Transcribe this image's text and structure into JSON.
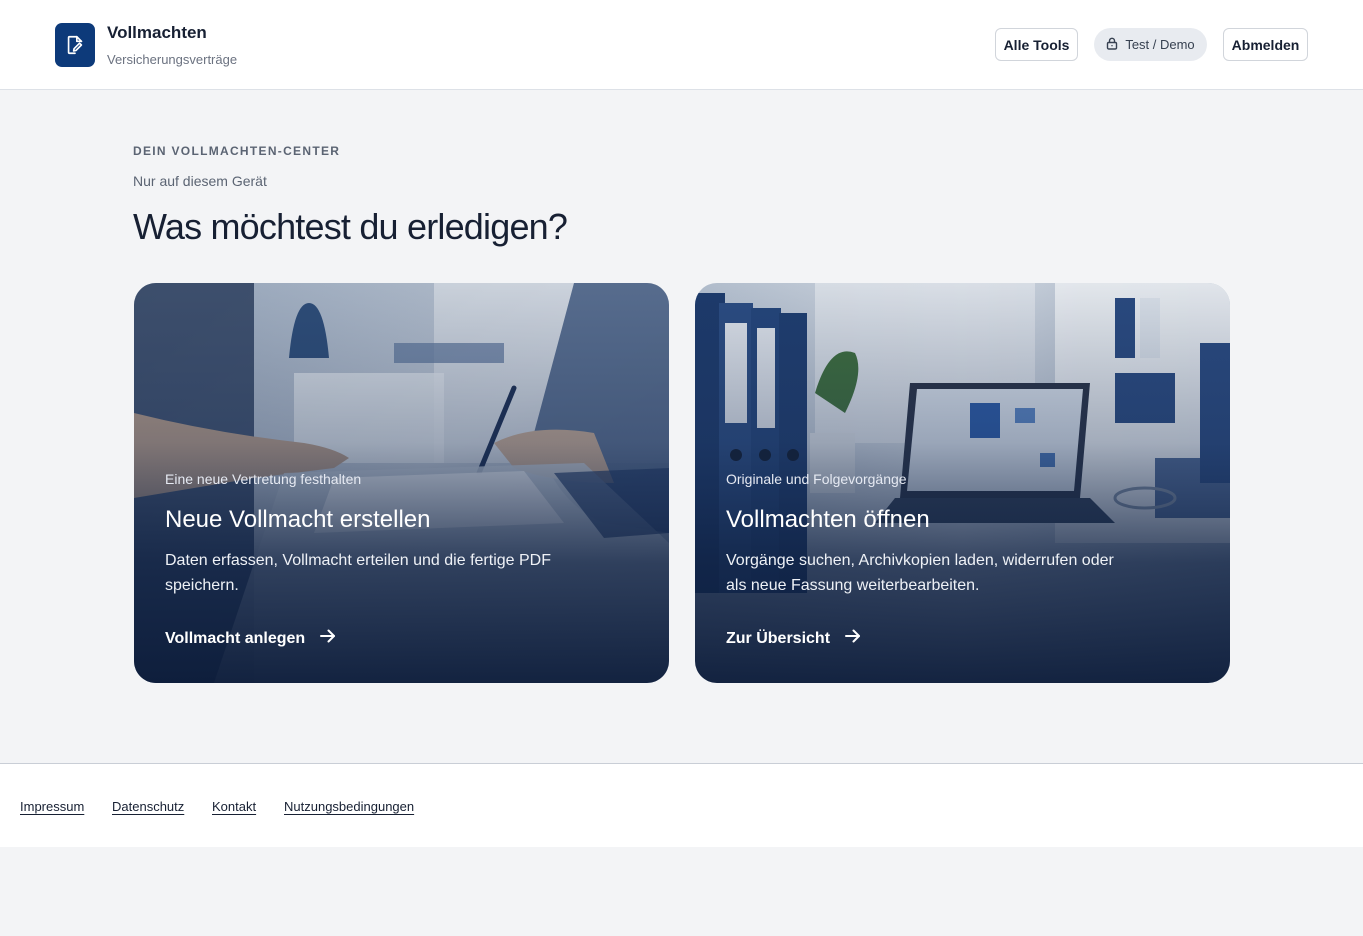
{
  "header": {
    "title": "Vollmachten",
    "subtitle": "Versicherungsverträge",
    "tools_label": "Alle Tools",
    "mode_label": "Test / Demo",
    "logout_label": "Abmelden"
  },
  "main": {
    "eyebrow": "DEIN VOLLMACHTEN-CENTER",
    "note": "Nur auf diesem Gerät",
    "headline": "Was möchtest du erledigen?",
    "cards": [
      {
        "kicker": "Eine neue Vertretung festhalten",
        "title": "Neue Vollmacht erstellen",
        "description": "Daten erfassen, Vollmacht erteilen und die fertige PDF speichern.",
        "cta": "Vollmacht anlegen"
      },
      {
        "kicker": "Originale und Folgevorgänge",
        "title": "Vollmachten öffnen",
        "description": "Vorgänge suchen, Archivkopien laden, widerrufen oder als neue Fassung weiterbearbeiten.",
        "cta": "Zur Übersicht"
      }
    ]
  },
  "footer": {
    "links": [
      "Impressum",
      "Datenschutz",
      "Kontakt",
      "Nutzungsbedingungen"
    ]
  },
  "colors": {
    "brand": "#0d3a7a",
    "text": "#172033",
    "background": "#f3f4f6"
  },
  "icons": {
    "logo": "document-edit-icon",
    "mode": "lock-icon",
    "cta": "arrow-right-icon"
  }
}
